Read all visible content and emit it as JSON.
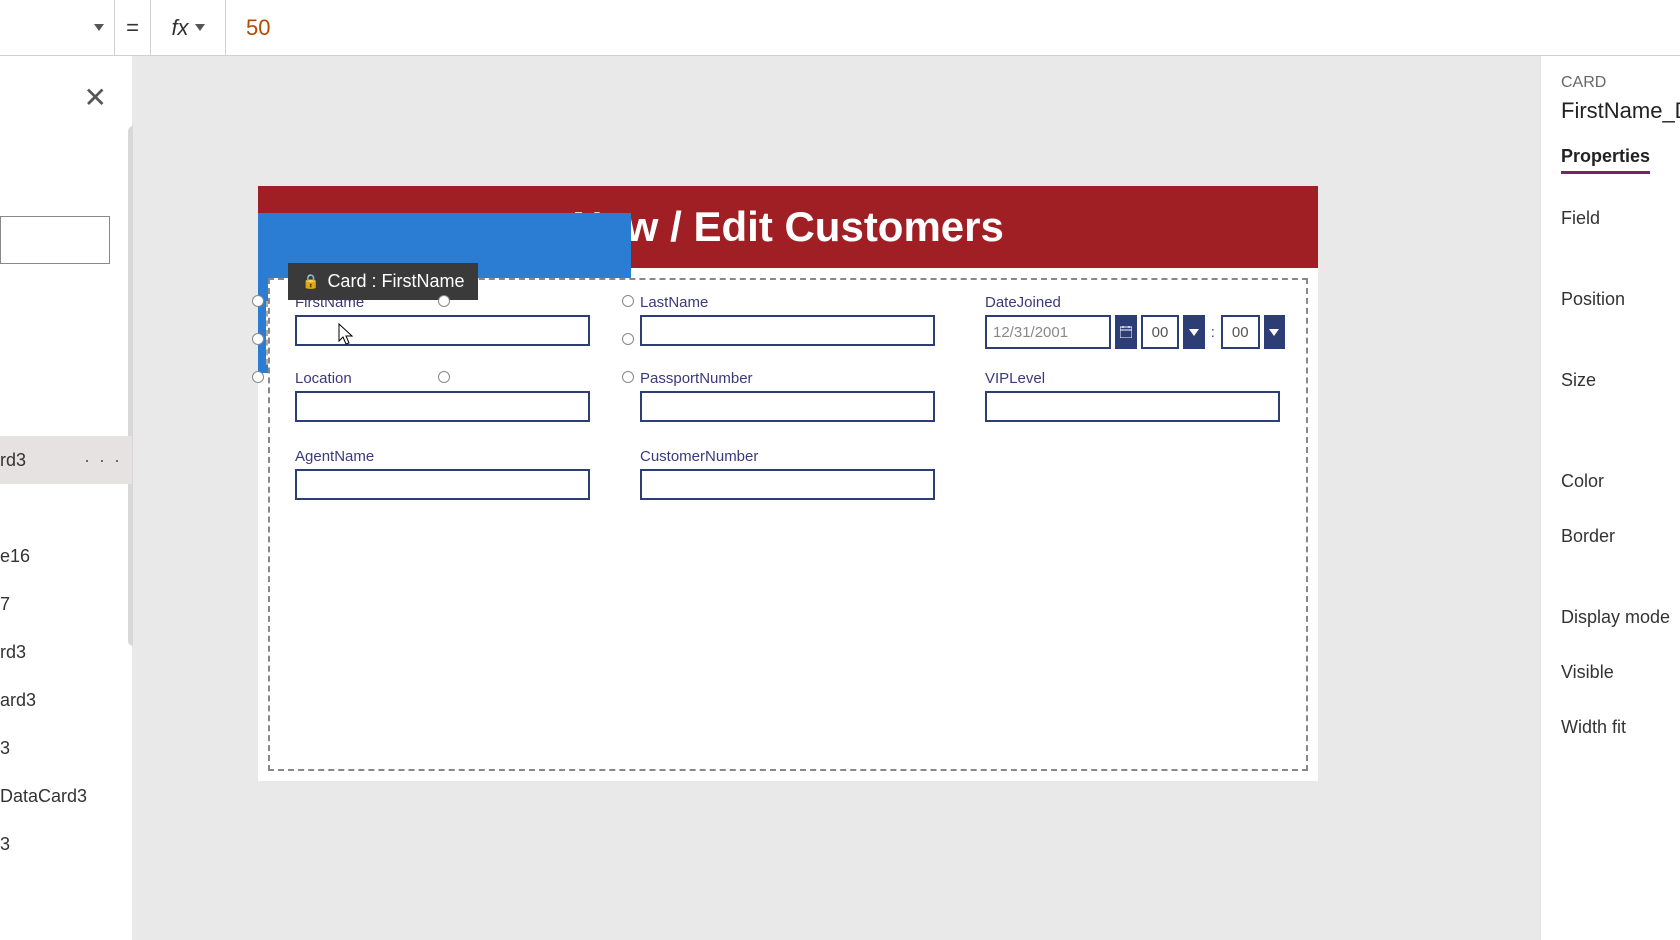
{
  "formula_bar": {
    "equals": "=",
    "fx": "fx",
    "value": "50"
  },
  "tree": {
    "items": [
      {
        "label": "rd3",
        "selected": true
      },
      {
        "label": ""
      },
      {
        "label": "e16"
      },
      {
        "label": "7"
      },
      {
        "label": "rd3"
      },
      {
        "label": "ard3"
      },
      {
        "label": "3"
      },
      {
        "label": "DataCard3"
      },
      {
        "label": "3"
      }
    ]
  },
  "screen": {
    "title": "New / Edit Customers"
  },
  "selection": {
    "label": "Card : FirstName"
  },
  "form": {
    "firstname": {
      "label": "FirstName"
    },
    "lastname": {
      "label": "LastName"
    },
    "datejoined": {
      "label": "DateJoined",
      "date_value": "12/31/2001",
      "hour": "00",
      "minute": "00",
      "colon": ":"
    },
    "location": {
      "label": "Location"
    },
    "passport": {
      "label": "PassportNumber"
    },
    "vip": {
      "label": "VIPLevel"
    },
    "agent": {
      "label": "AgentName"
    },
    "custno": {
      "label": "CustomerNumber"
    }
  },
  "right_panel": {
    "kind": "CARD",
    "name": "FirstName_D",
    "tab": "Properties",
    "rows": {
      "field": "Field",
      "position": "Position",
      "size": "Size",
      "color": "Color",
      "border": "Border",
      "display_mode": "Display mode",
      "visible": "Visible",
      "width_fit": "Width fit"
    }
  }
}
